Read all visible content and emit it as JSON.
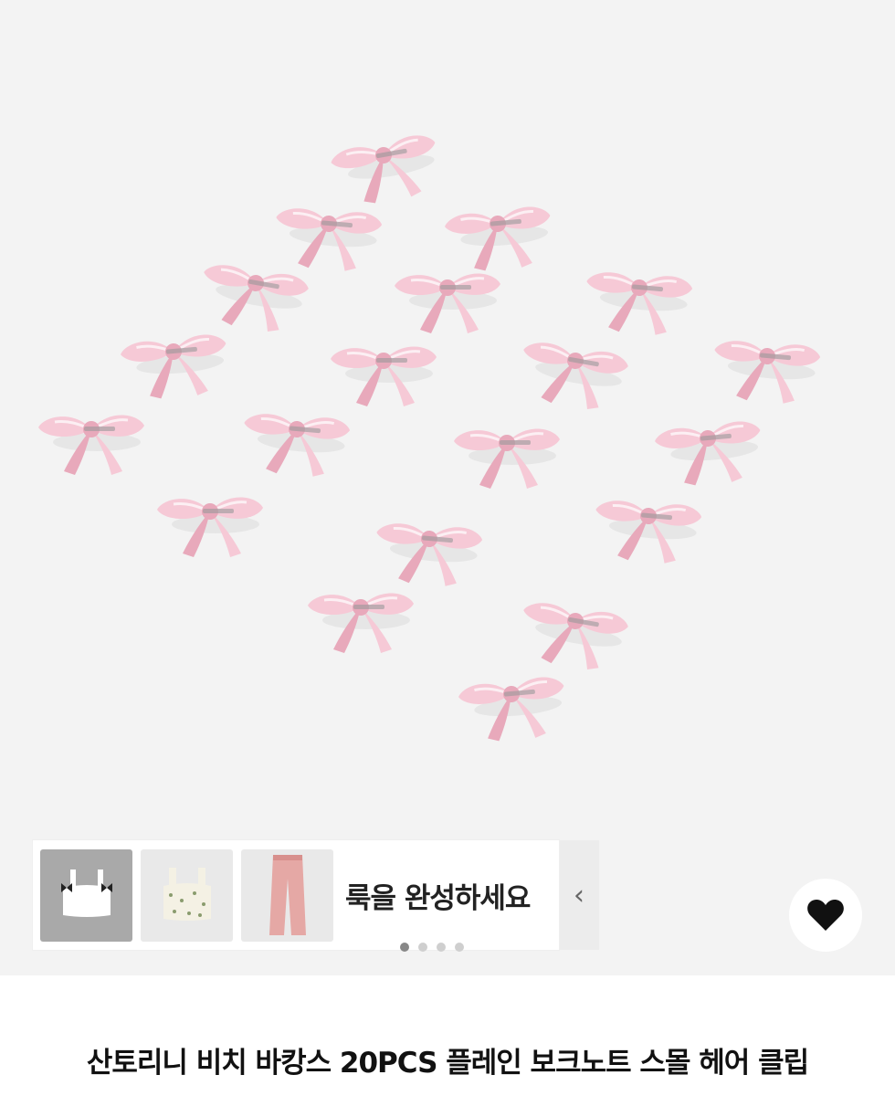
{
  "gallery": {
    "image_alt": "pink satin bow hair clips",
    "bow_count": 20,
    "bow_color": "#f6c9d6",
    "bow_shade": "#e8a9bb",
    "background": "#f3f3f3",
    "pager": {
      "current": 1,
      "total": 4
    }
  },
  "look": {
    "label": "룩을 완성하세요",
    "collapse_glyph": "‹",
    "thumbnails": [
      {
        "name": "white-bow-crop-top",
        "active": true
      },
      {
        "name": "floral-smocked-top",
        "active": false
      },
      {
        "name": "pink-pants",
        "active": false
      }
    ]
  },
  "favorite": {
    "icon": "heart-icon"
  },
  "product": {
    "title": "산토리니 비치 바캉스 20PCS 플레인 보크노트 스몰 헤어 클립"
  }
}
